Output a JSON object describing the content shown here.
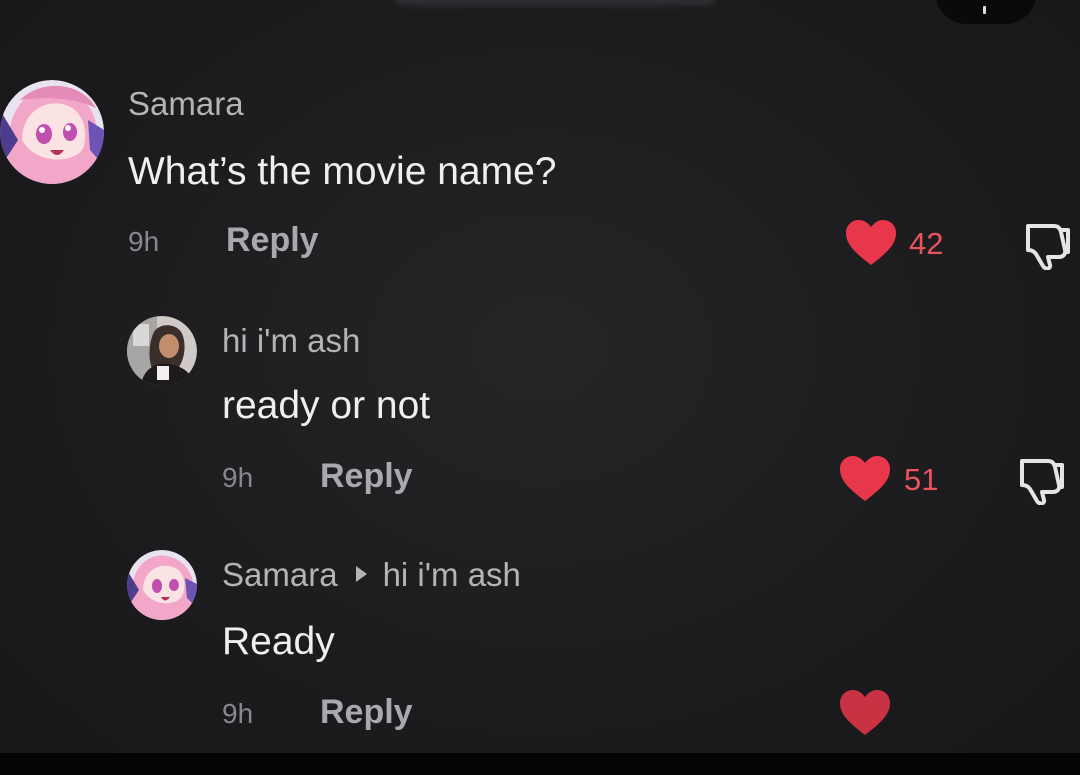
{
  "comments": [
    {
      "username": "Samara",
      "text": "What’s the movie name?",
      "time": "9h",
      "reply_label": "Reply",
      "likes": "42"
    },
    {
      "username": "hi i'm ash",
      "text": "ready or not",
      "time": "9h",
      "reply_label": "Reply",
      "likes": "51"
    },
    {
      "username": "Samara",
      "reply_to": "hi i'm ash",
      "text": "Ready",
      "time": "9h",
      "reply_label": "Reply"
    }
  ],
  "icons": {
    "like": "heart-icon",
    "dislike": "thumbs-down-icon",
    "reply_to": "play-triangle-icon"
  },
  "colors": {
    "background": "#1d1c1e",
    "like": "#e8374b",
    "like_count": "#e8535f",
    "username": "#b4b3b6",
    "text": "#efeef0"
  }
}
